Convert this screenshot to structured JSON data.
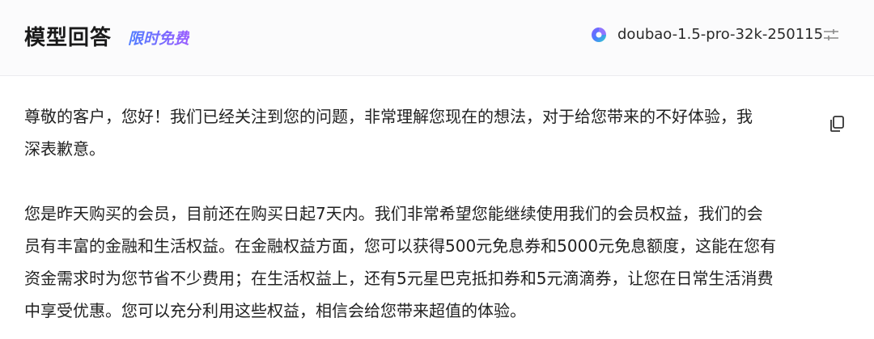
{
  "header": {
    "title": "模型回答",
    "badge": "限时免费",
    "model_name": "doubao-1.5-pro-32k-250115",
    "icons": {
      "model_logo": "doubao-logo-icon",
      "settings": "sliders-icon"
    }
  },
  "answer": {
    "paragraph1": [
      "尊敬的客户，您好！我们已经关注到您的问题，非常理解您现在的想法，对于给您带来的不好体验，我",
      "深表歉意。"
    ],
    "paragraph2": [
      "您是昨天购买的会员，目前还在购买日起7天内。我们非常希望您能继续使用我们的会员权益，我们的会",
      "员有丰富的金融和生活权益。在金融权益方面，您可以获得500元免息券和5000元免息额度，这能在您有",
      "资金需求时为您节省不少费用；在生活权益上，还有5元星巴克抵扣券和5元滴滴券，让您在日常生活消费",
      "中享受优惠。您可以充分利用这些权益，相信会给您带来超值的体验。"
    ],
    "copy_icon": "copy-icon"
  },
  "colors": {
    "badge_gradient_start": "#4d7dff",
    "badge_gradient_end": "#9a5cff",
    "header_bg": "#fbfbfc"
  }
}
